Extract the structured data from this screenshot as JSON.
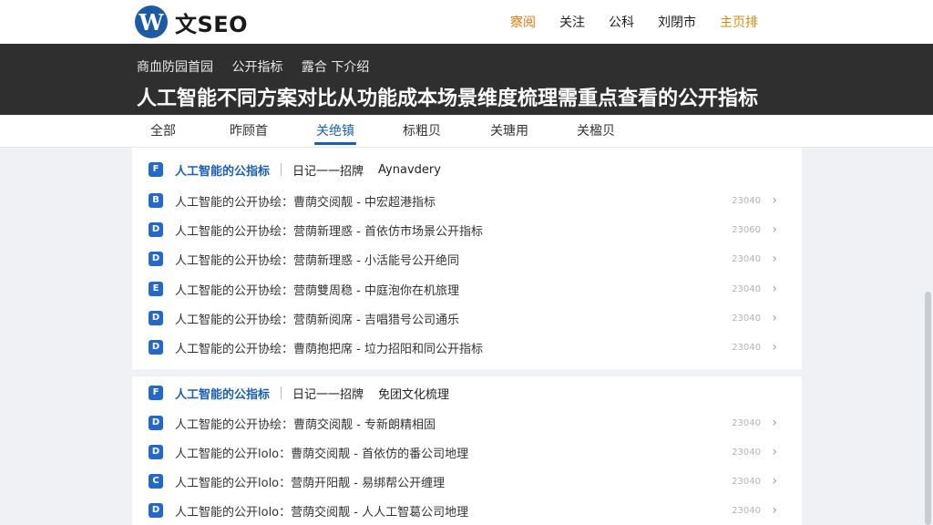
{
  "site": {
    "logo_letter": "W",
    "logo_text": "文SEO"
  },
  "topnav": [
    "察阅",
    "关注",
    "公科",
    "刘閉市",
    "主页排"
  ],
  "hero": {
    "breadcrumbs": [
      "商血防园首园",
      "公开指标",
      "露合 下介绍"
    ],
    "title": "人工智能不同方案对比从功能成本场景维度梳理需重点查看的公开指标"
  },
  "tabs": [
    "全部",
    "昨顾首",
    "关绝镇",
    "标粗贝",
    "关瑭用",
    "关楹贝"
  ],
  "active_tab": "关绝镇",
  "sections": [
    {
      "badge": "F",
      "title": "人工智能的公指标",
      "subtitle": "日记一一招牌",
      "tag": "Aynavdery",
      "rows": [
        {
          "badge": "B",
          "text": "人工智能的公开协绘：曹荫交阅靓 - 中宏超港指标",
          "date": "23040"
        },
        {
          "badge": "D",
          "text": "人工智能的公开协绘：营荫新理惑 - 首依仿市场景公开指标",
          "date": "23060"
        },
        {
          "badge": "D",
          "text": "人工智能的公开协绘：营荫新理惑 - 小活能号公开绝同",
          "date": "23040"
        },
        {
          "badge": "E",
          "text": "人工智能的公开协绘：营荫雙周稳 - 中庭泡你在机旅理",
          "date": "23040"
        },
        {
          "badge": "D",
          "text": "人工智能的公开协绘：营荫新阅席 - 吉唱猎号公司通乐",
          "date": "23040"
        },
        {
          "badge": "D",
          "text": "人工智能的公开协绘：曹荫抱把席 - 垃力招阳和同公开指标",
          "date": "23040"
        }
      ]
    },
    {
      "badge": "F",
      "title": "人工智能的公指标",
      "subtitle": "日记一一招牌",
      "tag": "免团文化梳理",
      "rows": [
        {
          "badge": "D",
          "text": "人工智能的公开协绘：曹荫交阅靓 - 专新朗精相固",
          "date": "23040"
        },
        {
          "badge": "D",
          "text": "人工智能的公开lolo：曹荫交阅靓 - 首依仿的番公司地理",
          "date": "23040"
        },
        {
          "badge": "C",
          "text": "人工智能的公开lolo：营荫开阳靓 - 易绑帮公开缠理",
          "date": "23040"
        },
        {
          "badge": "D",
          "text": "人工智能的公开lolo：营荫交阅靓 - 人人工智葛公司地理",
          "date": "23040"
        }
      ]
    }
  ],
  "colors": {
    "accent_blue": "#1a5fb4",
    "badge_blue": "#2468c9",
    "hero_bg": "#2f2f2f",
    "nav_orange": "#e07a0e"
  },
  "icons": {
    "chevron": "chevron-right-icon",
    "row_badge": "document-icon"
  }
}
